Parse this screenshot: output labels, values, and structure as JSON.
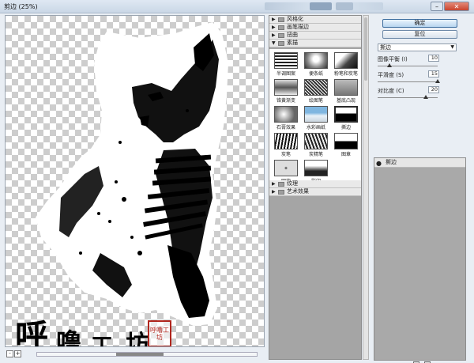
{
  "window": {
    "title": "剪边 (25%)",
    "close_glyph": "✕",
    "minimize_glyph": "–"
  },
  "canvas": {
    "watermark_chars": [
      "呼",
      "噜",
      "工",
      "坊"
    ],
    "stamp_text": "呼噜工坊",
    "zoom_minus": "-",
    "zoom_plus": "+"
  },
  "gallery": {
    "folders_top": [
      {
        "arrow": "▶",
        "label": "风格化"
      },
      {
        "arrow": "▶",
        "label": "画笔描边"
      },
      {
        "arrow": "▶",
        "label": "扭曲"
      },
      {
        "arrow": "▼",
        "label": "素描"
      }
    ],
    "thumbnails": [
      {
        "label": "半调图案",
        "selected": false
      },
      {
        "label": "便条纸",
        "selected": false
      },
      {
        "label": "粉笔和炭笔",
        "selected": false
      },
      {
        "label": "铬黄渐变",
        "selected": false
      },
      {
        "label": "绘图笔",
        "selected": false
      },
      {
        "label": "基底凸现",
        "selected": false
      },
      {
        "label": "石膏效果",
        "selected": false
      },
      {
        "label": "水彩画纸",
        "selected": false
      },
      {
        "label": "撕边",
        "selected": true
      },
      {
        "label": "炭笔",
        "selected": false
      },
      {
        "label": "炭精笔",
        "selected": false
      },
      {
        "label": "图章",
        "selected": false
      },
      {
        "label": "网状",
        "selected": false
      },
      {
        "label": "影印",
        "selected": false
      }
    ],
    "folders_bottom": [
      {
        "arrow": "▶",
        "label": "纹理"
      },
      {
        "arrow": "▶",
        "label": "艺术效果"
      }
    ]
  },
  "panel": {
    "ok_label": "确定",
    "reset_label": "复位",
    "filter_select": "撕边",
    "select_caret": "▼",
    "params": [
      {
        "label": "图像平衡 (I)",
        "value": "10",
        "max": 50
      },
      {
        "label": "平滑度 (S)",
        "value": "15",
        "max": 15
      },
      {
        "label": "对比度 (C)",
        "value": "20",
        "max": 25
      }
    ],
    "layer_name": "撕边",
    "eye_glyph": "●"
  }
}
